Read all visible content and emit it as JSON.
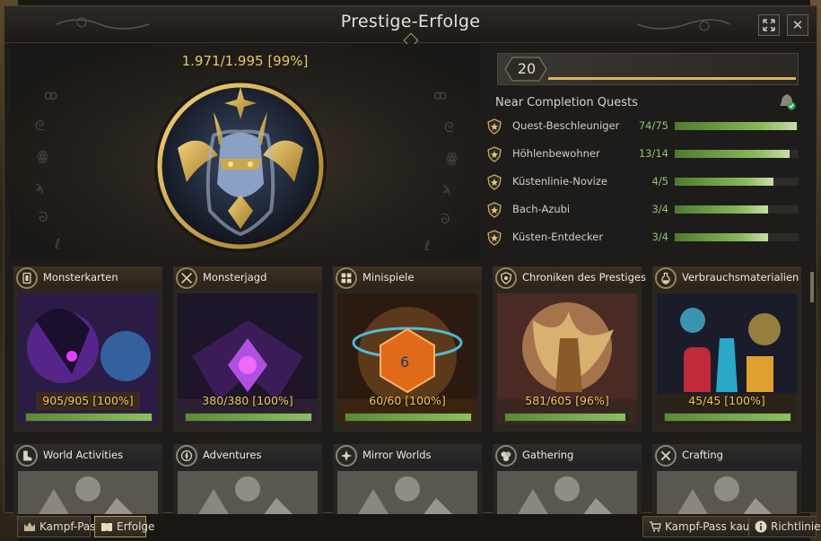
{
  "window": {
    "title": "Prestige-Erfolge"
  },
  "hero": {
    "total_progress": "1.971/1.995 [99%]"
  },
  "near_completion": {
    "level": "20",
    "title": "Near Completion Quests",
    "quests": [
      {
        "name": "Quest-Beschleuniger",
        "count": "74/75",
        "progress": 0.987
      },
      {
        "name": "Höhlenbewohner",
        "count": "13/14",
        "progress": 0.929
      },
      {
        "name": "Küstenlinie-Novize",
        "count": "4/5",
        "progress": 0.8
      },
      {
        "name": "Bach-Azubi",
        "count": "3/4",
        "progress": 0.75
      },
      {
        "name": "Küsten-Entdecker",
        "count": "3/4",
        "progress": 0.75
      }
    ]
  },
  "categories": [
    {
      "label": "Monsterkarten",
      "count": "905/905 [100%]",
      "progress": 1.0,
      "icon": "card-icon",
      "art": "purple"
    },
    {
      "label": "Monsterjagd",
      "count": "380/380 [100%]",
      "progress": 1.0,
      "icon": "crossed-swords-icon",
      "art": "violet"
    },
    {
      "label": "Minispiele",
      "count": "60/60 [100%]",
      "progress": 1.0,
      "icon": "grid-icon",
      "art": "dice"
    },
    {
      "label": "Chroniken des Prestiges",
      "count": "581/605 [96%]",
      "progress": 0.96,
      "icon": "shield-icon",
      "art": "gold"
    },
    {
      "label": "Verbrauchsmaterialien",
      "count": "45/45 [100%]",
      "progress": 1.0,
      "icon": "potion-icon",
      "art": "potions"
    }
  ],
  "categories_locked": [
    {
      "label": "World Activities",
      "icon": "boot-icon"
    },
    {
      "label": "Adventures",
      "icon": "compass-icon"
    },
    {
      "label": "Mirror Worlds",
      "icon": "star-burst-icon"
    },
    {
      "label": "Gathering",
      "icon": "ore-icon"
    },
    {
      "label": "Crafting",
      "icon": "hammer-icon"
    }
  ],
  "bottom_bar": {
    "battle_pass": "Kampf-Pass",
    "achievements": "Erfolge",
    "buy_battle_pass": "Kampf-Pass kaufen",
    "guidelines": "Richtlinie"
  },
  "colors": {
    "gold": "#e9c46a",
    "progress_green": "#8cc060",
    "window_bg": "#1e1c1a"
  }
}
